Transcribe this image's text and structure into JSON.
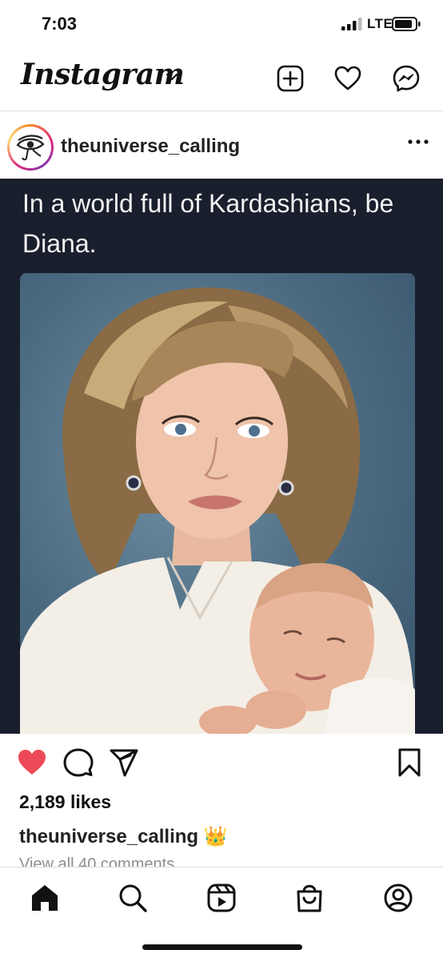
{
  "status_bar": {
    "time": "7:03",
    "network": "LTE"
  },
  "header": {
    "logo": "Instagram"
  },
  "post": {
    "username": "theuniverse_calling",
    "image_caption": "In a world full of Kardashians, be Diana.",
    "likes": "2,189 likes",
    "caption_user": "theuniverse_calling",
    "caption_emoji": "👑",
    "view_comments": "View all 40 comments",
    "liked": true
  },
  "colors": {
    "like_red": "#ed4956",
    "divider": "#dbdbdb",
    "image_bg": "#1a1f2d"
  },
  "icons": {
    "header": [
      "new-post-icon",
      "activity-heart-icon",
      "messenger-icon"
    ],
    "actions": [
      "like-icon",
      "comment-icon",
      "share-icon",
      "save-icon"
    ],
    "bottom_nav": [
      "home-icon",
      "search-icon",
      "reels-icon",
      "shop-icon",
      "profile-icon"
    ]
  }
}
